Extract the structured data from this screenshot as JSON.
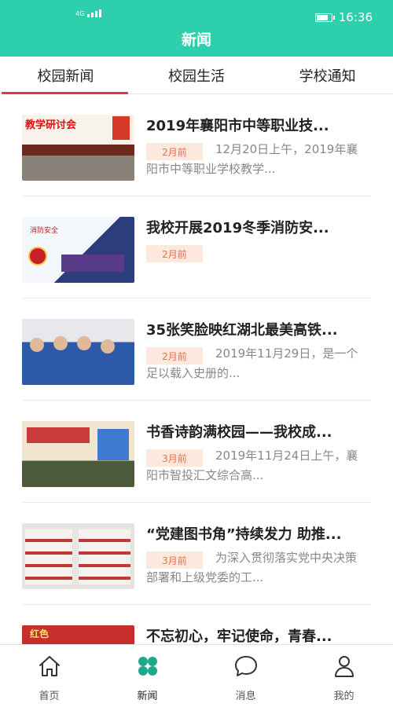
{
  "status_bar": {
    "signal": "4G",
    "time": "16:36",
    "battery_level": 0.8
  },
  "header": {
    "title": "新闻"
  },
  "tabs": [
    "校园新闻",
    "校园生活",
    "学校通知"
  ],
  "news": [
    {
      "title": "2019年襄阳市中等职业技...",
      "time": "2月前",
      "summary": "12月20日上午，2019年襄阳市中等职业学校教学..."
    },
    {
      "title": "我校开展2019冬季消防安...",
      "time": "2月前",
      "summary": ""
    },
    {
      "title": "35张笑脸映红湖北最美高铁...",
      "time": "2月前",
      "summary": "2019年11月29日，是一个足以载入史册的..."
    },
    {
      "title": "书香诗韵满校园——我校成...",
      "time": "3月前",
      "summary": "2019年11月24日上午，襄阳市智投汇文综合高..."
    },
    {
      "title": "“党建图书角”持续发力 助推...",
      "time": "3月前",
      "summary": "为深入贯彻落实党中央决策部署和上级党委的工..."
    },
    {
      "title": "不忘初心，牢记使命，青春...",
      "time": "",
      "summary": ""
    }
  ],
  "thumb_texts": {
    "t1": "教学研讨会",
    "t2": "消防安全",
    "t6": "红色"
  },
  "bottom_nav": [
    {
      "label": "首页",
      "icon": "home-icon"
    },
    {
      "label": "新闻",
      "icon": "clover-icon"
    },
    {
      "label": "消息",
      "icon": "chat-bubble-icon"
    },
    {
      "label": "我的",
      "icon": "user-icon"
    }
  ],
  "colors": {
    "accent": "#2ecfad",
    "tab_indicator": "#e8363a",
    "badge_bg": "#fde8dd",
    "badge_text": "#e8704a"
  }
}
